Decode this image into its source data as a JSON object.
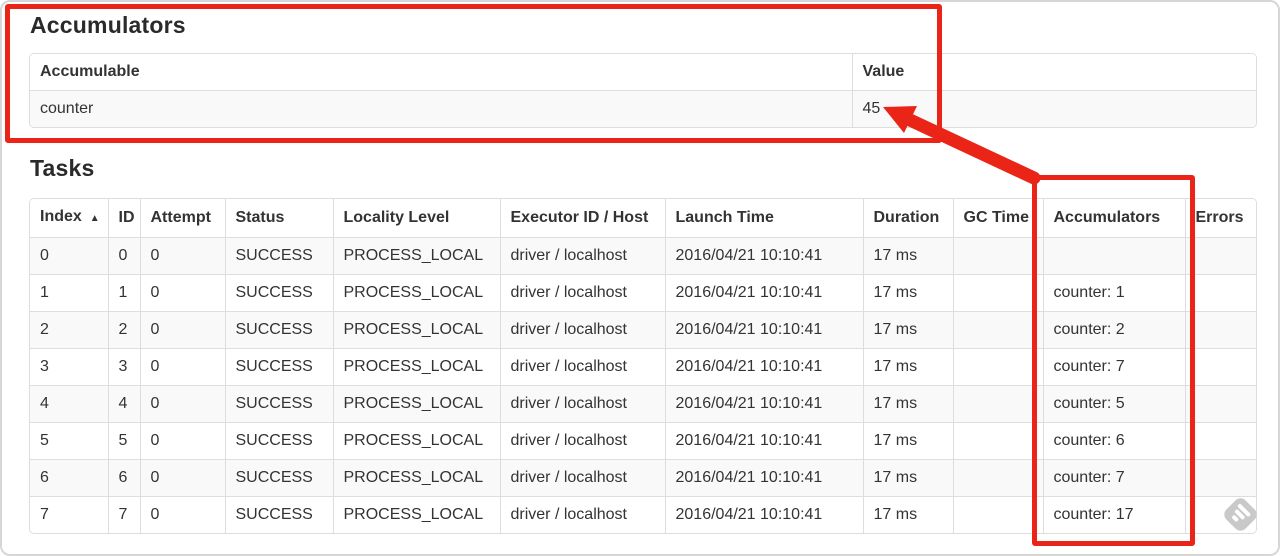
{
  "annotations": {
    "color": "#ea2517",
    "watermark_icon": "feedly-logo"
  },
  "accumulators_section": {
    "title": "Accumulators",
    "table": {
      "headers": [
        "Accumulable",
        "Value"
      ],
      "rows": [
        {
          "accumulable": "counter",
          "value": "45"
        }
      ]
    }
  },
  "tasks_section": {
    "title": "Tasks",
    "table": {
      "headers": [
        "Index",
        "ID",
        "Attempt",
        "Status",
        "Locality Level",
        "Executor ID / Host",
        "Launch Time",
        "Duration",
        "GC Time",
        "Accumulators",
        "Errors"
      ],
      "sort_column": "Index",
      "sort_icon": "▲",
      "rows": [
        {
          "index": "0",
          "id": "0",
          "attempt": "0",
          "status": "SUCCESS",
          "locality_level": "PROCESS_LOCAL",
          "executor": "driver / localhost",
          "launch_time": "2016/04/21 10:10:41",
          "duration": "17 ms",
          "gc_time": "",
          "accumulators": "",
          "errors": ""
        },
        {
          "index": "1",
          "id": "1",
          "attempt": "0",
          "status": "SUCCESS",
          "locality_level": "PROCESS_LOCAL",
          "executor": "driver / localhost",
          "launch_time": "2016/04/21 10:10:41",
          "duration": "17 ms",
          "gc_time": "",
          "accumulators": "counter: 1",
          "errors": ""
        },
        {
          "index": "2",
          "id": "2",
          "attempt": "0",
          "status": "SUCCESS",
          "locality_level": "PROCESS_LOCAL",
          "executor": "driver / localhost",
          "launch_time": "2016/04/21 10:10:41",
          "duration": "17 ms",
          "gc_time": "",
          "accumulators": "counter: 2",
          "errors": ""
        },
        {
          "index": "3",
          "id": "3",
          "attempt": "0",
          "status": "SUCCESS",
          "locality_level": "PROCESS_LOCAL",
          "executor": "driver / localhost",
          "launch_time": "2016/04/21 10:10:41",
          "duration": "17 ms",
          "gc_time": "",
          "accumulators": "counter: 7",
          "errors": ""
        },
        {
          "index": "4",
          "id": "4",
          "attempt": "0",
          "status": "SUCCESS",
          "locality_level": "PROCESS_LOCAL",
          "executor": "driver / localhost",
          "launch_time": "2016/04/21 10:10:41",
          "duration": "17 ms",
          "gc_time": "",
          "accumulators": "counter: 5",
          "errors": ""
        },
        {
          "index": "5",
          "id": "5",
          "attempt": "0",
          "status": "SUCCESS",
          "locality_level": "PROCESS_LOCAL",
          "executor": "driver / localhost",
          "launch_time": "2016/04/21 10:10:41",
          "duration": "17 ms",
          "gc_time": "",
          "accumulators": "counter: 6",
          "errors": ""
        },
        {
          "index": "6",
          "id": "6",
          "attempt": "0",
          "status": "SUCCESS",
          "locality_level": "PROCESS_LOCAL",
          "executor": "driver / localhost",
          "launch_time": "2016/04/21 10:10:41",
          "duration": "17 ms",
          "gc_time": "",
          "accumulators": "counter: 7",
          "errors": ""
        },
        {
          "index": "7",
          "id": "7",
          "attempt": "0",
          "status": "SUCCESS",
          "locality_level": "PROCESS_LOCAL",
          "executor": "driver / localhost",
          "launch_time": "2016/04/21 10:10:41",
          "duration": "17 ms",
          "gc_time": "",
          "accumulators": "counter: 17",
          "errors": ""
        }
      ]
    }
  }
}
